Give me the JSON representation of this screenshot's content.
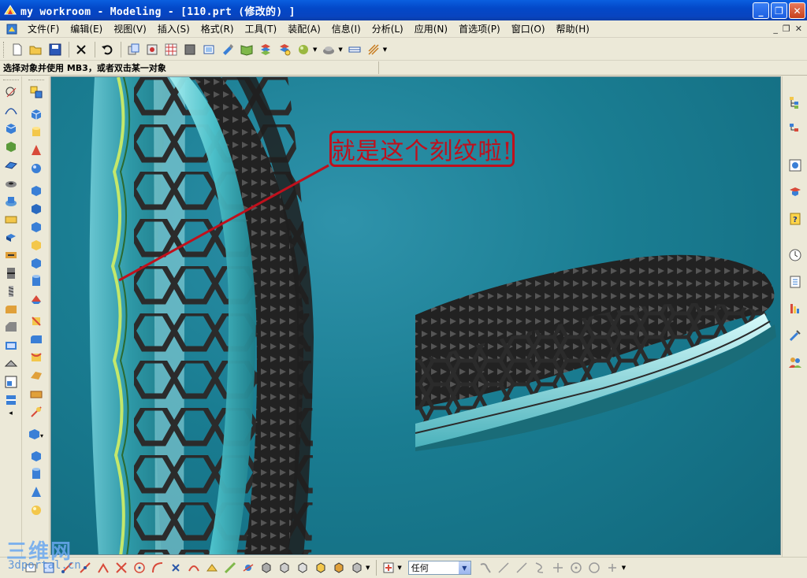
{
  "window": {
    "title": "my workroom - Modeling - [110.prt  (修改的) ]",
    "buttons": {
      "minimize": "_",
      "maximize": "❐",
      "close": "✕"
    }
  },
  "menubar": {
    "items": [
      "文件(F)",
      "编辑(E)",
      "视图(V)",
      "插入(S)",
      "格式(R)",
      "工具(T)",
      "装配(A)",
      "信息(I)",
      "分析(L)",
      "应用(N)",
      "首选项(P)",
      "窗口(O)",
      "帮助(H)"
    ],
    "mdi": {
      "minimize": "_",
      "restore": "❐",
      "close": "✕"
    }
  },
  "toolbar": {
    "icons": [
      "new-file-icon",
      "open-folder-icon",
      "save-icon",
      "delete-icon",
      "undo-icon",
      "copy-icon",
      "snap-icon",
      "grid-icon",
      "surface-icon",
      "orient-view-icon",
      "paint-icon",
      "book-icon",
      "layer-icon",
      "layer-settings-icon",
      "shaded-sphere-icon",
      "render-style-icon",
      "hide-icon",
      "edge-icon"
    ]
  },
  "prompt": {
    "text": "选择对象并使用 MB3，或者双击某一对象"
  },
  "viewport": {
    "annotation": "就是这个刻纹啦!",
    "colors": {
      "background": "#1a7d92",
      "annotation": "#c0101c",
      "mesh": "#2b2b2b",
      "surface": "#7fd8e0"
    }
  },
  "bottom_toolbar": {
    "filter_value": "任何",
    "filter_arrow": "▼"
  },
  "watermark": {
    "cn": "三维网",
    "en": "3dportal.cn"
  }
}
